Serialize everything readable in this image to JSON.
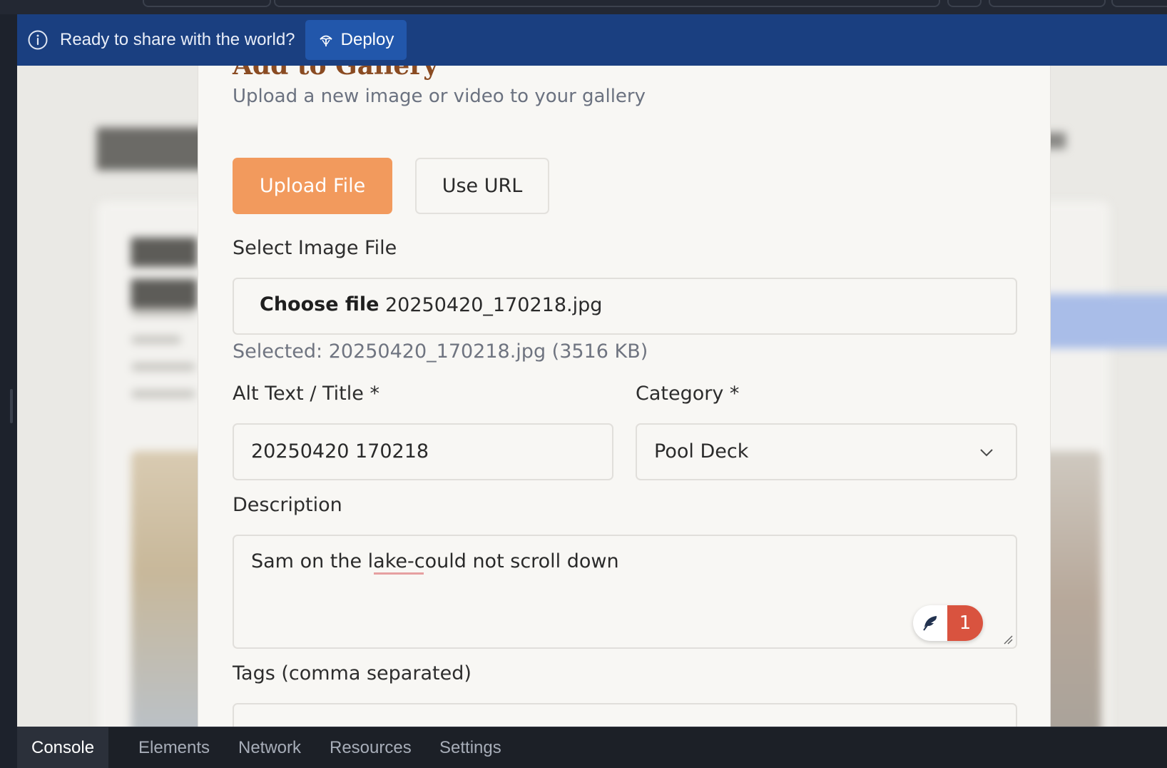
{
  "banner": {
    "message": "Ready to share with the world?",
    "deploy_label": "Deploy",
    "icons": {
      "info": "info-icon",
      "deploy": "deploy-icon"
    }
  },
  "modal": {
    "title": "Add to Gallery",
    "subtitle": "Upload a new image or video to your gallery",
    "tabs": [
      {
        "label": "Upload File",
        "active": true
      },
      {
        "label": "Use URL",
        "active": false
      }
    ],
    "file": {
      "label": "Select Image File",
      "choose_label": "Choose file",
      "file_name": "20250420_170218.jpg",
      "selected_note": "Selected: 20250420_170218.jpg (3516 KB)"
    },
    "alt_text": {
      "label": "Alt Text / Title *",
      "value": "20250420 170218"
    },
    "category": {
      "label": "Category *",
      "value": "Pool Deck"
    },
    "description": {
      "label": "Description",
      "value": "Sam on the lake-could not scroll down"
    },
    "grammar_badge": {
      "count": "1",
      "icon": "feather-icon"
    },
    "tags": {
      "label": "Tags (comma separated)",
      "value": ""
    }
  },
  "devtools": {
    "tabs": [
      "Console",
      "Elements",
      "Network",
      "Resources",
      "Settings"
    ],
    "active_tab": "Console"
  },
  "colors": {
    "banner_bg": "#1a3f80",
    "deploy_btn": "#2257ab",
    "primary_tab": "#f29a5d",
    "title_brown": "#8a4b22",
    "badge_red": "#d9533f"
  }
}
